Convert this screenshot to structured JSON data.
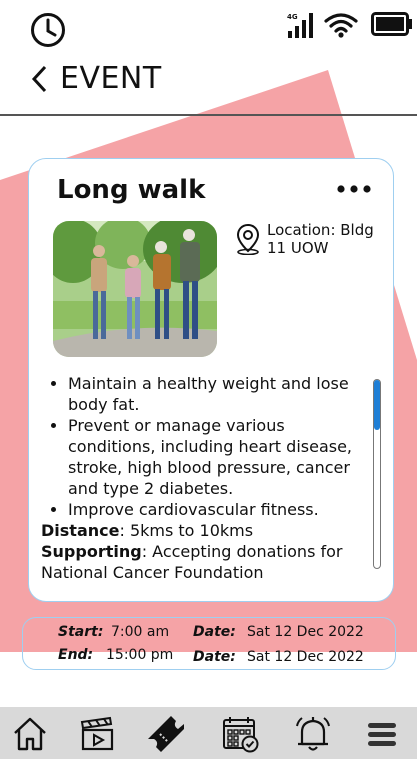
{
  "status": {
    "clock_icon": "clock-icon",
    "network": "4G",
    "signal_icon": "signal-icon",
    "wifi_icon": "wifi-icon",
    "battery_icon": "battery-icon"
  },
  "header": {
    "back_icon": "chevron-left-icon",
    "title": "EVENT"
  },
  "event": {
    "title": "Long walk",
    "more_icon": "more-horizontal-icon",
    "location_icon": "map-pin-icon",
    "location": "Location: Bldg 11 UOW",
    "benefits": [
      "Maintain a healthy weight and lose body fat.",
      "Prevent or manage various conditions, including heart disease, stroke, high blood pressure, cancer and type 2 diabetes.",
      "Improve cardiovascular fitness."
    ],
    "distance_label": "Distance",
    "distance_value": ": 5kms to 10kms",
    "supporting_label": "Supporting",
    "supporting_value": ": Accepting donations for National Cancer Foundation"
  },
  "schedule": {
    "start_label": "Start:",
    "start_time": "7:00 am",
    "start_date_label": "Date:",
    "start_date": "Sat 12 Dec 2022",
    "end_label": "End:",
    "end_time": "15:00 pm",
    "end_date_label": "Date:",
    "end_date": "Sat 12 Dec 2022"
  },
  "nav": {
    "items": [
      {
        "icon": "home-icon"
      },
      {
        "icon": "clapperboard-icon"
      },
      {
        "icon": "ticket-icon"
      },
      {
        "icon": "calendar-check-icon"
      },
      {
        "icon": "bell-icon"
      },
      {
        "icon": "menu-icon"
      }
    ]
  },
  "colors": {
    "accent_shape": "#f5a3a6",
    "card_border": "#9fcff0",
    "scroll_thumb": "#1f7fd6",
    "nav_background": "#d9d9d9"
  }
}
